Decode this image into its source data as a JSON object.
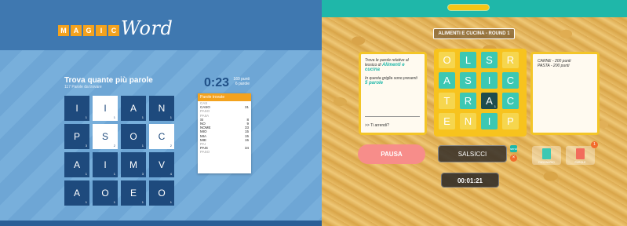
{
  "left": {
    "logo_letters": [
      "M",
      "A",
      "G",
      "I",
      "C"
    ],
    "logo_word": "Word",
    "title": "Trova quante più parole",
    "subtitle": "117 Parole da trovare",
    "timer": "0:23",
    "points": "169 punti",
    "words_count": "6 parole",
    "grid": [
      [
        {
          "l": "I",
          "p": "1"
        },
        {
          "l": "I",
          "p": "1",
          "sel": true
        },
        {
          "l": "A",
          "p": "1"
        },
        {
          "l": "N",
          "p": "1"
        }
      ],
      [
        {
          "l": "P",
          "p": "3"
        },
        {
          "l": "S",
          "p": "2",
          "sel": true
        },
        {
          "l": "O",
          "p": "1"
        },
        {
          "l": "C",
          "p": "2",
          "sel": true
        }
      ],
      [
        {
          "l": "A",
          "p": "1"
        },
        {
          "l": "I",
          "p": "1"
        },
        {
          "l": "M",
          "p": "3"
        },
        {
          "l": "V",
          "p": "4"
        }
      ],
      [
        {
          "l": "A",
          "p": "1"
        },
        {
          "l": "O",
          "p": "1"
        },
        {
          "l": "E",
          "p": "1"
        },
        {
          "l": "O",
          "p": "1"
        }
      ]
    ],
    "found_header": "Parole trovate",
    "found": [
      {
        "w": "CAS",
        "s": "",
        "prefix": true
      },
      {
        "w": "CASO",
        "s": "31"
      },
      {
        "w": "PASO",
        "s": "",
        "prefix": true
      },
      {
        "w": "PAIIA",
        "s": "",
        "prefix": true
      },
      {
        "w": "SI",
        "s": "8"
      },
      {
        "w": "NO",
        "s": "9"
      },
      {
        "w": "NOME",
        "s": "33"
      },
      {
        "w": "MIO",
        "s": "15"
      },
      {
        "w": "MIA",
        "s": "15"
      },
      {
        "w": "MIE",
        "s": "15"
      },
      {
        "w": "PAI",
        "s": "",
        "prefix": true
      },
      {
        "w": "PAIS",
        "s": "34"
      },
      {
        "w": "PASO",
        "s": "",
        "prefix": true
      }
    ]
  },
  "right": {
    "round_label": "ALIMENTI E CUCINA - ROUND 1",
    "progress": 1.0,
    "hint_line1_pre": "Trova le parole relative al lessico di",
    "hint_line1_hl": "Alimenti e cucina",
    "hint_line2_pre": "In questa griglia sono presenti",
    "hint_line2_hl": "5 parole",
    "hint_next": ">> Ti arrendi?",
    "words_found": [
      "CARNE - 200 punti",
      "PASTA - 200 punti"
    ],
    "grid": [
      [
        {
          "l": "O",
          "t": "y"
        },
        {
          "l": "L",
          "t": "g"
        },
        {
          "l": "S",
          "t": "g"
        },
        {
          "l": "R",
          "t": "y"
        }
      ],
      [
        {
          "l": "A",
          "t": "g"
        },
        {
          "l": "S",
          "t": "g"
        },
        {
          "l": "I",
          "t": "g"
        },
        {
          "l": "C",
          "t": "g"
        }
      ],
      [
        {
          "l": "T",
          "t": "y"
        },
        {
          "l": "R",
          "t": "g"
        },
        {
          "l": "A",
          "t": "d",
          "p": "1"
        },
        {
          "l": "C",
          "t": "g"
        }
      ],
      [
        {
          "l": "E",
          "t": "y"
        },
        {
          "l": "N",
          "t": "y"
        },
        {
          "l": "I",
          "t": "g"
        },
        {
          "l": "P",
          "t": "y"
        }
      ]
    ],
    "pause_label": "PAUSA",
    "current_word": "SALSICCI",
    "send_label": "send",
    "delete_label": "×",
    "timer": "00:01:21",
    "tool_dict_label": "DIZIONARIO",
    "tool_hist_label": "PAROLE",
    "badge": "1"
  },
  "colors": {
    "accent": "#1fb7a9",
    "tile_yellow": "#f6d64e",
    "left_tile": "#1e4a7d",
    "orange": "#f3a21e"
  }
}
